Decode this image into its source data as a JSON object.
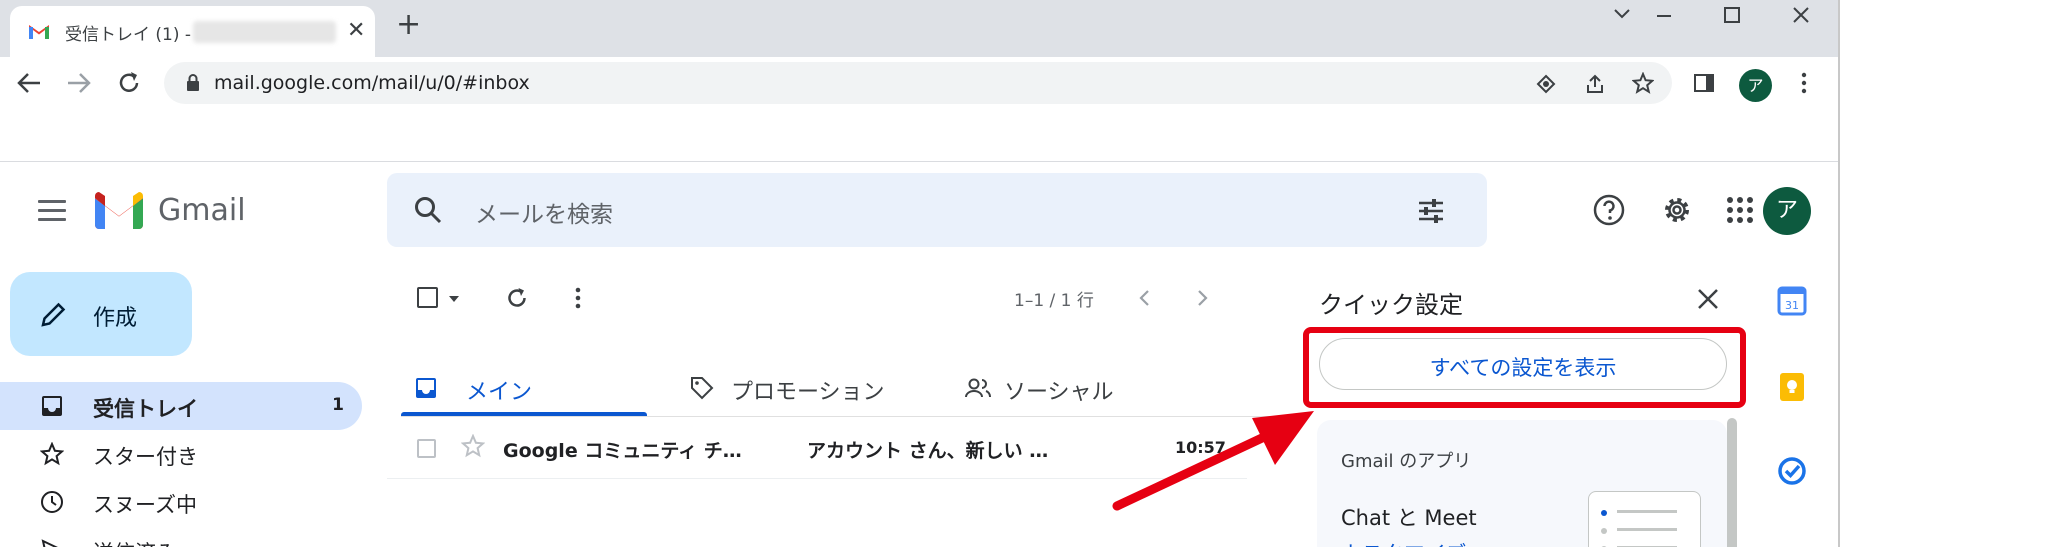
{
  "browser": {
    "tab_title": "受信トレイ (1) -",
    "tab_close": "✕",
    "new_tab": "+",
    "url": "mail.google.com/mail/u/0/#inbox",
    "profile_initial": "ア"
  },
  "gmail": {
    "product_name": "Gmail",
    "search_placeholder": "メールを検索",
    "avatar_initial": "ア"
  },
  "sidebar": {
    "compose_label": "作成",
    "items": [
      {
        "label": "受信トレイ",
        "count": "1"
      },
      {
        "label": "スター付き"
      },
      {
        "label": "スヌーズ中"
      },
      {
        "label": "送信済み"
      }
    ]
  },
  "mail_list": {
    "range": "1–1 / 1 行",
    "tabs": [
      {
        "label": "メイン"
      },
      {
        "label": "プロモーション"
      },
      {
        "label": "ソーシャル"
      }
    ],
    "rows": [
      {
        "sender": "Google コミュニティ チ…",
        "subject": "アカウント さん、新しい …",
        "time": "10:57"
      }
    ]
  },
  "quick_settings": {
    "title": "クイック設定",
    "all_settings_button": "すべての設定を表示",
    "apps_heading": "Gmail のアプリ",
    "chat_meet": "Chat と Meet",
    "customize": "カスタマイズ"
  },
  "colors": {
    "highlight": "#e60012",
    "accent_blue": "#0b57d0",
    "compose_bg": "#c2e7ff",
    "active_nav": "#d3e3fd",
    "avatar": "#0d5a3f"
  }
}
